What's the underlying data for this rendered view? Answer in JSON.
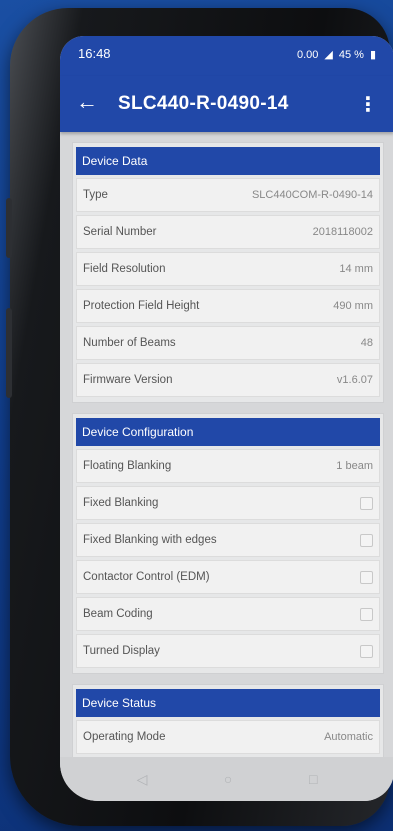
{
  "status": {
    "time": "16:48",
    "network": "0.00",
    "battery": "45 %"
  },
  "appbar": {
    "title": "SLC440-R-0490-14"
  },
  "sections": {
    "device_data": {
      "title": "Device Data",
      "rows": [
        {
          "label": "Type",
          "value": "SLC440COM-R-0490-14"
        },
        {
          "label": "Serial Number",
          "value": "2018118002"
        },
        {
          "label": "Field Resolution",
          "value": "14 mm"
        },
        {
          "label": "Protection Field Height",
          "value": "490 mm"
        },
        {
          "label": "Number of Beams",
          "value": "48"
        },
        {
          "label": "Firmware Version",
          "value": "v1.6.07"
        }
      ]
    },
    "device_configuration": {
      "title": "Device Configuration",
      "rows": [
        {
          "label": "Floating Blanking",
          "value": "1 beam"
        },
        {
          "label": "Fixed Blanking",
          "checked": false
        },
        {
          "label": "Fixed Blanking with edges",
          "checked": false
        },
        {
          "label": "Contactor Control (EDM)",
          "checked": false
        },
        {
          "label": "Beam Coding",
          "checked": false
        },
        {
          "label": "Turned Display",
          "checked": false
        }
      ]
    },
    "device_status": {
      "title": "Device Status",
      "rows": [
        {
          "label": "Operating Mode",
          "value": "Automatic"
        }
      ]
    }
  },
  "navbar": {
    "back": "◁",
    "home": "○",
    "recents": "□"
  }
}
